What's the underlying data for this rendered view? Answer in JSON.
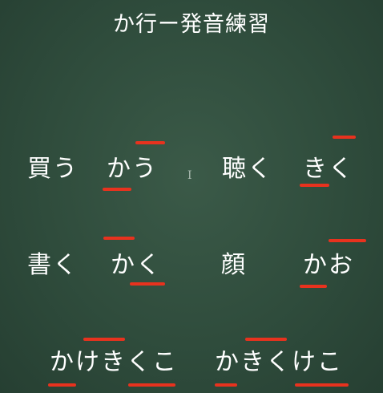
{
  "title": "か行ー発音練習",
  "accent_color": "#e8321e",
  "cursor_icon": "text-cursor-icon",
  "rows": [
    {
      "items": [
        {
          "kanji": "買う",
          "reading": "かう"
        },
        {
          "kanji": "聴く",
          "reading": "きく"
        }
      ]
    },
    {
      "items": [
        {
          "kanji": "書く",
          "reading": "かく"
        },
        {
          "kanji": "顔",
          "reading": "かお"
        }
      ]
    },
    {
      "items": [
        {
          "reading": "かけきくこ"
        },
        {
          "reading": "かきくけこ"
        }
      ]
    }
  ]
}
